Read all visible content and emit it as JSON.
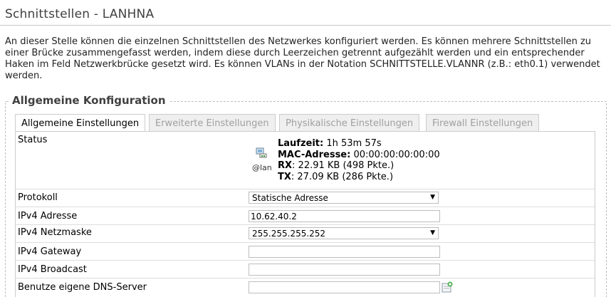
{
  "page": {
    "title": "Schnittstellen - LANHNA",
    "intro": "An dieser Stelle können die einzelnen Schnittstellen des Netzwerkes konfiguriert werden. Es können mehrere Schnittstellen zu einer Brücke zusammengefasst werden, indem diese durch Leerzeichen getrennt aufgezählt werden und ein entsprechender Haken im Feld Netzwerkbrücke gesetzt wird. Es können VLANs in der Notation SCHNITTSTELLE.VLANNR (z.B.: eth0.1) verwendet werden."
  },
  "section": {
    "legend": "Allgemeine Konfiguration",
    "tabs": [
      {
        "label": "Allgemeine Einstellungen",
        "active": true
      },
      {
        "label": "Erweiterte Einstellungen",
        "active": false
      },
      {
        "label": "Physikalische Einstellungen",
        "active": false
      },
      {
        "label": "Firewall Einstellungen",
        "active": false
      }
    ]
  },
  "status": {
    "label": "Status",
    "iface": "@lan",
    "uptime_label": "Laufzeit:",
    "uptime_value": "1h 53m 57s",
    "mac_label": "MAC-Adresse:",
    "mac_value": "00:00:00:00:00:00",
    "rx_label": "RX",
    "rx_value": ": 22.91 KB (498 Pkte.)",
    "tx_label": "TX",
    "tx_value": ": 27.09 KB (286 Pkte.)"
  },
  "fields": {
    "protocol": {
      "label": "Protokoll",
      "value": "Statische Adresse"
    },
    "ipv4_address": {
      "label": "IPv4 Adresse",
      "value": "10.62.40.2"
    },
    "ipv4_netmask": {
      "label": "IPv4 Netzmaske",
      "value": "255.255.255.252"
    },
    "ipv4_gateway": {
      "label": "IPv4 Gateway",
      "value": ""
    },
    "ipv4_broadcast": {
      "label": "IPv4 Broadcast",
      "value": ""
    },
    "dns": {
      "label": "Benutze eigene DNS-Server",
      "value": ""
    }
  },
  "icons": {
    "status": "network-port-icon",
    "dns_add": "add-field-icon",
    "select_arrow": "dropdown-arrow-icon"
  }
}
